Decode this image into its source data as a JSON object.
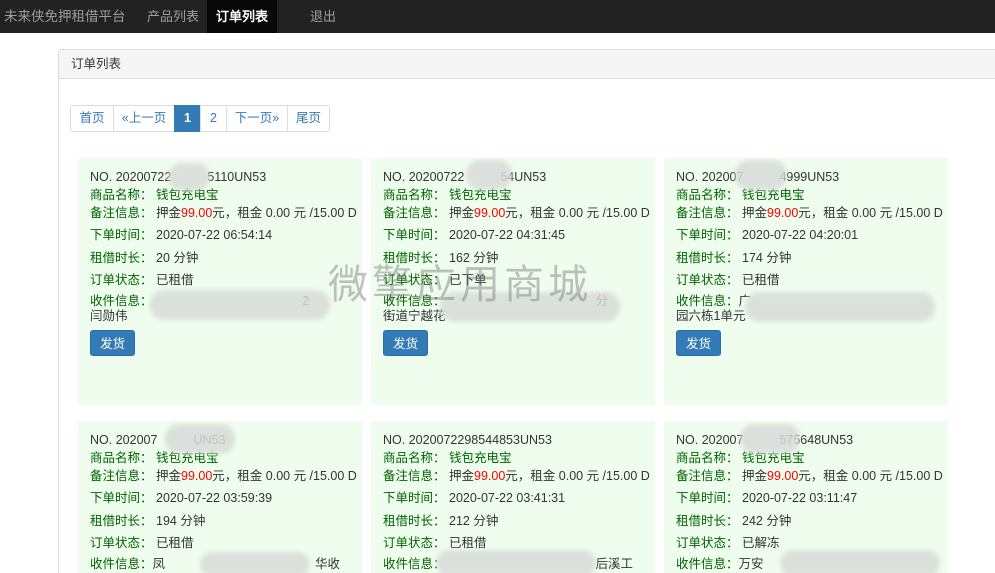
{
  "navbar": {
    "brand": "未来侠免押租借平台",
    "items": [
      {
        "label": "产品列表"
      },
      {
        "label": "订单列表"
      },
      {
        "label": "退出"
      }
    ]
  },
  "panel": {
    "title": "订单列表"
  },
  "pagination": {
    "first": "首页",
    "prev": "«上一页",
    "pages": [
      "1",
      "2"
    ],
    "current": "1",
    "next": "下一页»",
    "last": "尾页"
  },
  "labels": {
    "no": "NO.",
    "product": "商品名称：",
    "note": "备注信息：",
    "time": "下单时间：",
    "duration": "租借时长：",
    "status": "订单状态：",
    "address": "收件信息：",
    "ship": "发货"
  },
  "orders": [
    {
      "no": "20200722",
      "no_tail": "5110UN53",
      "product": "钱包充电宝",
      "deposit_prefix": "押金",
      "deposit": "99.00",
      "note_rest": "元，租金 0.00 元 /15.00 D",
      "time": "2020-07-22 06:54:14",
      "duration": "20 分钟",
      "status": "已租借",
      "address_head": "",
      "address_tail": "2",
      "address_line2": "闫勋伟"
    },
    {
      "no": "20200722",
      "no_tail": "54UN53",
      "product": "钱包充电宝",
      "deposit_prefix": "押金",
      "deposit": "99.00",
      "note_rest": "元，租金 0.00 元 /15.00 D",
      "time": "2020-07-22 04:31:45",
      "duration": "162 分钟",
      "status": "已下单",
      "address_head": "",
      "address_tail": "分",
      "address_line2": "街道宁越花"
    },
    {
      "no": "202007",
      "no_tail": "4999UN53",
      "product": "钱包充电宝",
      "deposit_prefix": "押金",
      "deposit": "99.00",
      "note_rest": "元，租金 0.00 元 /15.00 D",
      "time": "2020-07-22 04:20:01",
      "duration": "174 分钟",
      "status": "已租借",
      "address_head": "广",
      "address_tail": "",
      "address_line2": "园六栋1单元"
    },
    {
      "no": "202007",
      "no_tail": "UN53",
      "product": "钱包充电宝",
      "deposit_prefix": "押金",
      "deposit": "99.00",
      "note_rest": "元，租金 0.00 元 /15.00 D",
      "time": "2020-07-22 03:59:39",
      "duration": "194 分钟",
      "status": "已租借",
      "address_head": "凤",
      "address_tail": "华收",
      "address_line2": ""
    },
    {
      "no": "2020072298544853UN53",
      "no_tail": "",
      "product": "钱包充电宝",
      "deposit_prefix": "押金",
      "deposit": "99.00",
      "note_rest": "元，租金 0.00 元 /15.00 D",
      "time": "2020-07-22 03:41:31",
      "duration": "212 分钟",
      "status": "已租借",
      "address_head": "",
      "address_tail": "后溪工",
      "address_line2": ""
    },
    {
      "no": "202007",
      "no_tail": "575648UN53",
      "product": "钱包充电宝",
      "deposit_prefix": "押金",
      "deposit": "99.00",
      "note_rest": "元，租金 0.00 元 /15.00 D",
      "time": "2020-07-22 03:11:47",
      "duration": "242 分钟",
      "status": "已解冻",
      "address_head": "万安",
      "address_tail": "",
      "address_line2": ""
    }
  ],
  "watermark": "微擎应用商城",
  "colors": {
    "navbar_bg": "#222222",
    "card_bg": "#eefdee",
    "label_green": "#006400",
    "deposit_red": "#ff0000",
    "primary": "#337ab7"
  }
}
